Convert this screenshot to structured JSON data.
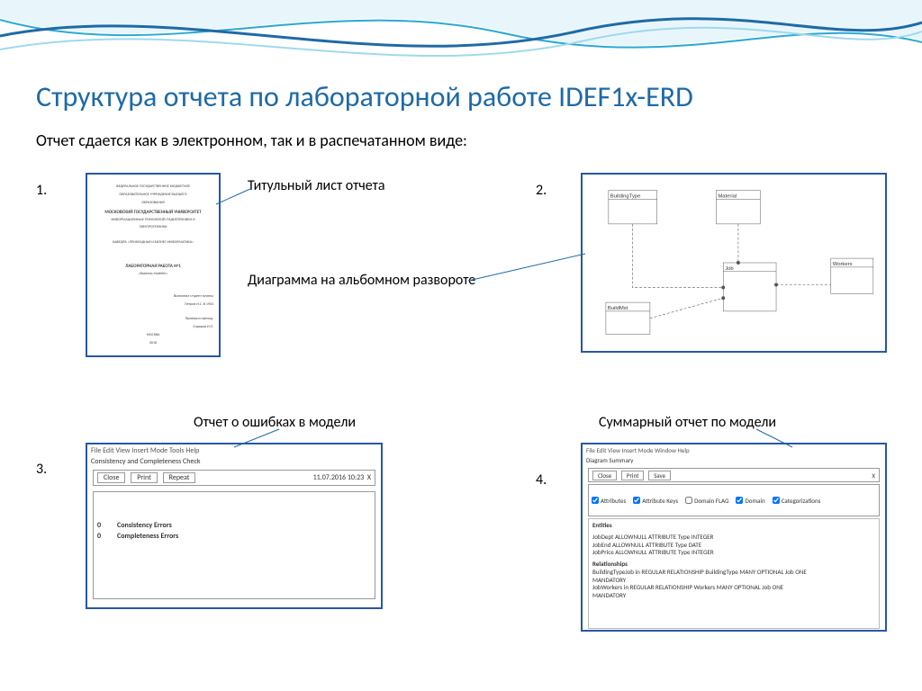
{
  "title": "Структура отчета по лабораторной работе IDEF1x-ERD",
  "subtitle": "Отчет сдается как в электронном, так и в распечатанном виде:",
  "items": {
    "n1": "1.",
    "n2": "2.",
    "n3": "3.",
    "n4": "4.",
    "label1": "Титульный лист отчета",
    "label2": "Диаграмма на альбомном развороте",
    "label3": "Отчет о ошибках в модели",
    "label4": "Суммарный отчет по модели"
  },
  "thumb1": {
    "l1": "ФЕДЕРАЛЬНОЕ ГОСУДАРСТВЕННОЕ БЮДЖЕТНОЕ",
    "l2": "ОБРАЗОВАТЕЛЬНОЕ УЧРЕЖДЕНИЕ ВЫСШЕГО",
    "l3": "ОБРАЗОВАНИЯ",
    "l4": "МОСКОВСКИЙ ГОСУДАРСТВЕННЫЙ УНИВЕРСИТЕТ",
    "l5": "ИНФОРМАЦИОННЫХ ТЕХНОЛОГИЙ, РАДИОТЕХНИКИ И",
    "l6": "ЭЛЕКТРОТЕХНИКИ",
    "l7": "КАФЕДРА «ПРИКЛАДНАЯ И БИЗНЕС-ИНФОРМАТИКА»",
    "l8": "ЛАБОРАТОРНАЯ РАБОТА №1",
    "l9": "«Business Modeler»",
    "l10": "Выполнил студент группы",
    "l11": "Петров И.С. В 1903",
    "l12": "Проверил препод.",
    "l13": "Сидоров Н.П.",
    "l14": "МОСКВА",
    "l15": "2016"
  },
  "thumb2": {
    "entities": {
      "e1": "BuildingType",
      "e2": "Material",
      "e3": "Job",
      "e4": "Workers",
      "e5": "BuildMst"
    }
  },
  "thumb3": {
    "menubar": "File  Edit  View  Insert  Mode  Tools  Help",
    "title": "Consistency and Completeness Check",
    "btn1": "Close",
    "btn2": "Print",
    "btn3": "Repeat",
    "ts": "11.07.2016 10:23",
    "x": "X",
    "r1n": "0",
    "r1t": "Consistency Errors",
    "r2n": "0",
    "r2t": "Completeness Errors"
  },
  "thumb4": {
    "menubar": "File  Edit  View  Insert  Mode  Window  Help",
    "title": "Diagram Summary",
    "btn1": "Close",
    "btn2": "Print",
    "btn3": "Save",
    "x": "X",
    "opt1": "Attributes",
    "opt2": "Attribute Keys",
    "opt3": "Domain FLAG",
    "opt4": "Domain",
    "opt5": "Categorizations",
    "line1": "Entities",
    "line2": "JobDept  ALLOWNULL ATTRIBUTE Type  INTEGER",
    "line3": "JobEnd   ALLOWNULL ATTRIBUTE Type DATE",
    "line4": "JobPrice  ALLOWNULL ATTRIBUTE Type  INTEGER",
    "line5": "Relationships",
    "line6": "BuildingTypeJob in REGULAR RELATIONSHIP BuildingType MANY OPTIONAL Job ONE",
    "line7": "MANDATORY",
    "line8": "JobWorkers in REGULAR RELATIONSHIP Workers MANY OPTIONAL Job ONE",
    "line9": "MANDATORY"
  }
}
